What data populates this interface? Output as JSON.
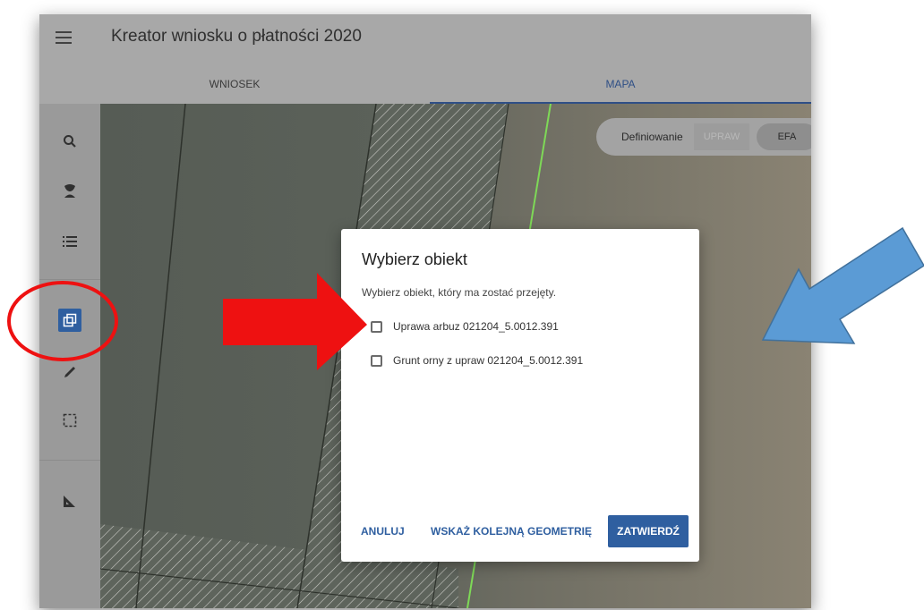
{
  "app": {
    "title": "Kreator wniosku o płatności 2020"
  },
  "tabs": [
    {
      "label": "WNIOSEK",
      "active": false
    },
    {
      "label": "MAPA",
      "active": true
    }
  ],
  "sidebar": {
    "items": [
      {
        "icon": "search-icon"
      },
      {
        "icon": "plant-icon"
      },
      {
        "icon": "list-icon"
      },
      {
        "icon": "copy-geometry-icon",
        "active": true
      },
      {
        "icon": "pencil-icon"
      },
      {
        "icon": "dashed-rectangle-select-icon"
      },
      {
        "icon": "ruler-triangle-icon"
      }
    ]
  },
  "map_toggle": {
    "label": "Definiowanie",
    "options": [
      "UPRAW",
      "EFA"
    ],
    "selected": "EFA"
  },
  "dialog": {
    "title": "Wybierz obiekt",
    "subtitle": "Wybierz obiekt, który ma zostać przejęty.",
    "options": [
      {
        "label": "Uprawa arbuz 021204_5.0012.391",
        "checked": false
      },
      {
        "label": "Grunt orny z upraw 021204_5.0012.391",
        "checked": false
      }
    ],
    "buttons": {
      "cancel": "ANULUJ",
      "next_geometry": "WSKAŻ KOLEJNĄ GEOMETRIĘ",
      "confirm": "ZATWIERDŹ"
    }
  },
  "colors": {
    "accent": "#2f5fa0",
    "annotation_red": "#ee1111",
    "annotation_blue": "#5b9bd5",
    "field_boundary": "#7ed957"
  }
}
